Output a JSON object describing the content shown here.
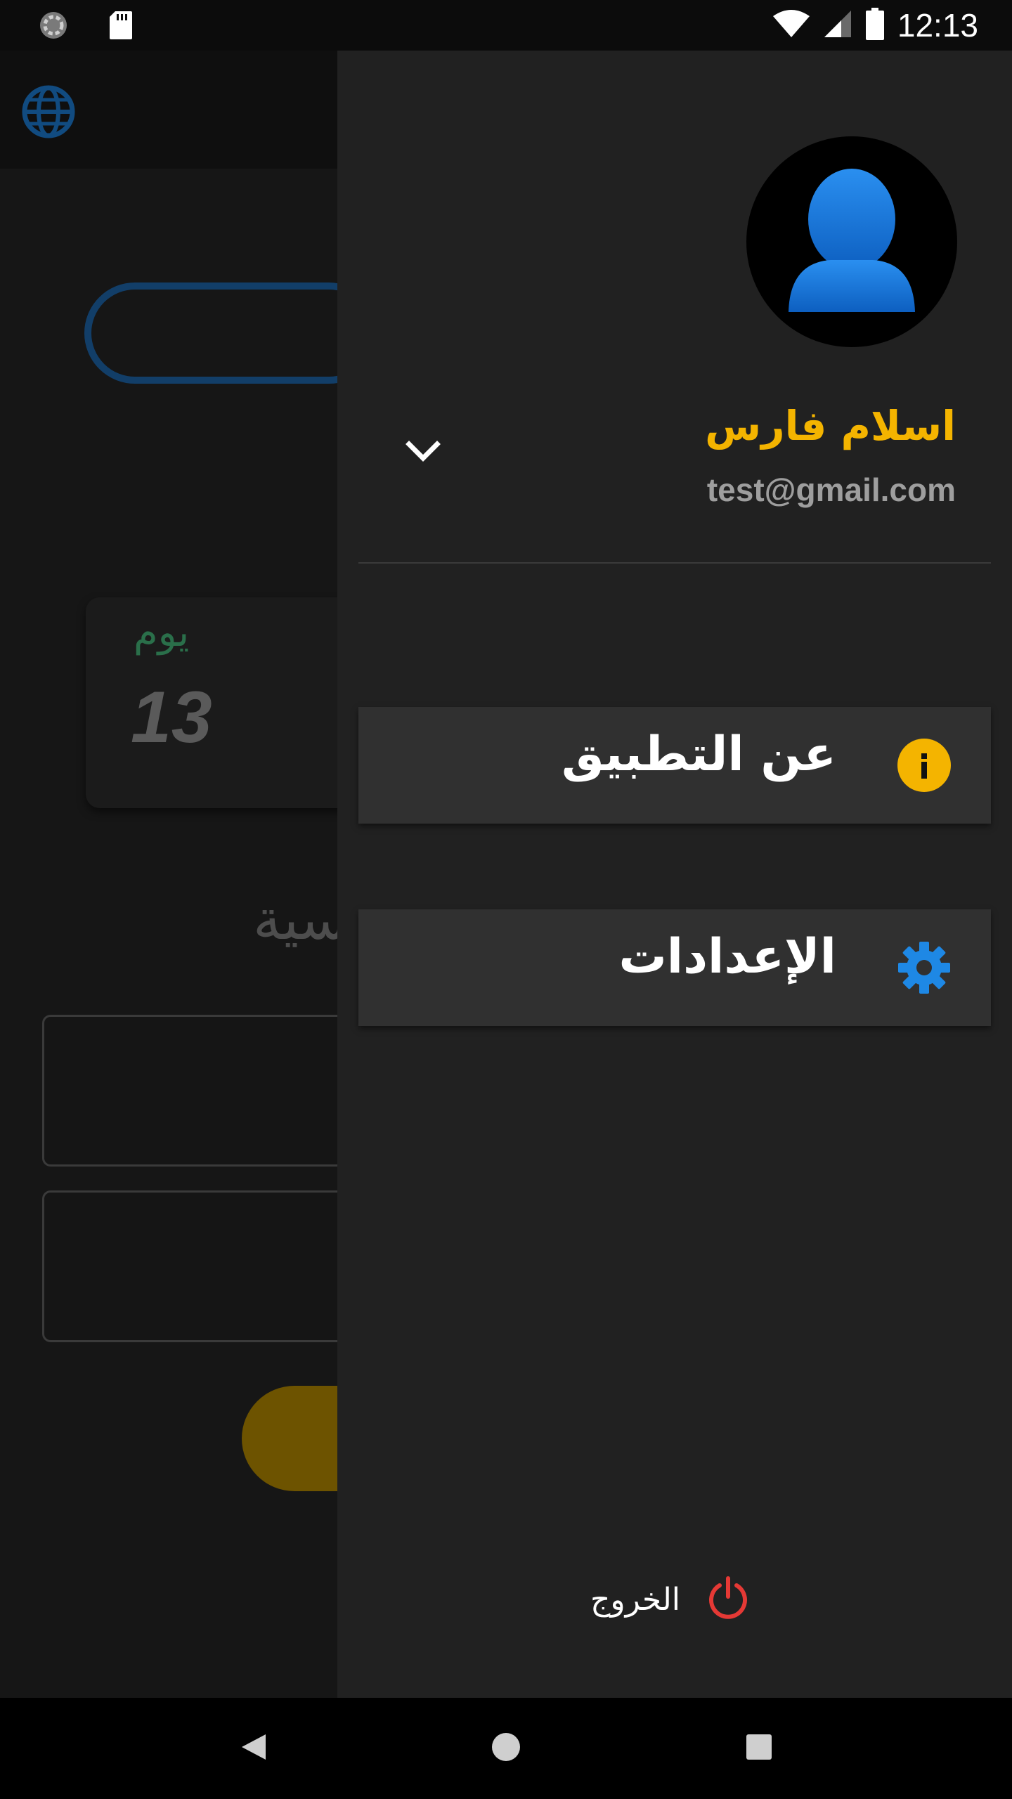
{
  "status_bar": {
    "time": "12:13"
  },
  "background": {
    "day_label": "يوم",
    "day_value": "13",
    "heading_fragment": "سية"
  },
  "drawer": {
    "user": {
      "name": "اسلام فارس",
      "email": "test@gmail.com"
    },
    "menu": [
      {
        "label": "عن التطبيق",
        "icon": "info-icon",
        "icon_color": "#f4b400"
      },
      {
        "label": "الإعدادات",
        "icon": "gear-icon",
        "icon_color": "#1e88e5"
      }
    ],
    "logout": {
      "label": "الخروج",
      "icon": "power-icon",
      "icon_color": "#e53935"
    }
  },
  "colors": {
    "accent_yellow": "#f4b400",
    "accent_blue": "#1e88e5",
    "drawer_bg": "#212121",
    "menu_item_bg": "#303030"
  }
}
